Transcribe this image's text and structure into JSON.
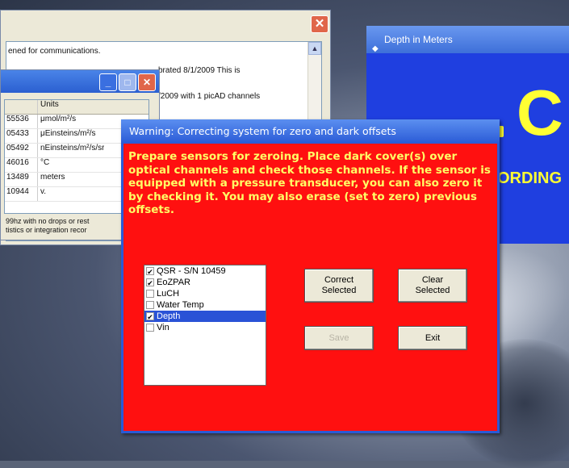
{
  "log_window": {
    "lines": [
      "ened for communications.",
      "brated 8/1/2009 This is",
      "/2009 with 1 picAD channels"
    ]
  },
  "units_window": {
    "header": [
      "",
      "Units"
    ],
    "rows": [
      [
        "55536",
        "μmol/m²/s"
      ],
      [
        "05433",
        "μEinsteins/m²/s"
      ],
      [
        "05492",
        "nEinsteins/m²/s/sr"
      ],
      [
        "46016",
        "°C"
      ],
      [
        "13489",
        "meters"
      ],
      [
        "10944",
        "v."
      ]
    ],
    "note_lines": [
      "99hz with no drops or rest",
      "tistics or integration recor"
    ]
  },
  "depth_window": {
    "title": "Depth in Meters",
    "value": "C",
    "status": "ORDING"
  },
  "dialog": {
    "title": "Warning: Correcting system for zero and dark offsets",
    "message": "Prepare sensors for zeroing.  Place dark cover(s) over optical channels and check those channels.  If the sensor is equipped with a pressure transducer, you can also zero it by checking it.  You may also erase (set to zero) previous offsets.",
    "channels": [
      {
        "label": "QSR - S/N 10459",
        "checked": true,
        "selected": false
      },
      {
        "label": "EoZPAR",
        "checked": true,
        "selected": false
      },
      {
        "label": "LuCH",
        "checked": false,
        "selected": false
      },
      {
        "label": "Water Temp",
        "checked": false,
        "selected": false
      },
      {
        "label": "Depth",
        "checked": true,
        "selected": true
      },
      {
        "label": "Vin",
        "checked": false,
        "selected": false
      }
    ],
    "buttons": {
      "correct_line1": "Correct",
      "correct_line2": "Selected",
      "clear_line1": "Clear",
      "clear_line2": "Selected",
      "save": "Save",
      "exit": "Exit"
    }
  },
  "colors": {
    "dialog_bg": "#ff1010",
    "message_text": "#ffff66",
    "titlebar": "#2a5ad6",
    "depth_bg": "#1f3fe0"
  }
}
